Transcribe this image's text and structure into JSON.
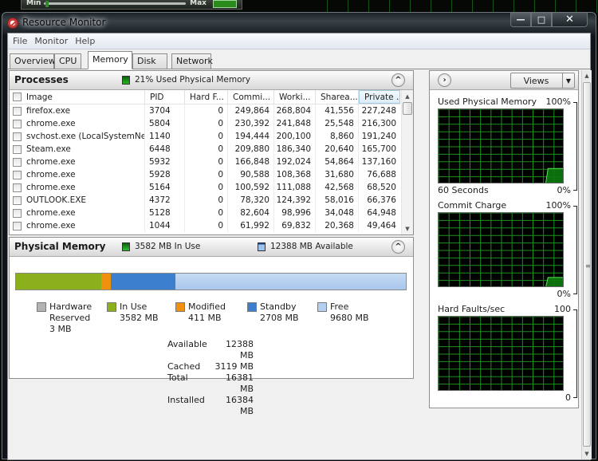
{
  "background": {
    "slider_min_label": "Min",
    "slider_max_label": "Max"
  },
  "window": {
    "title": "Resource Monitor",
    "icon": "resource-monitor-icon",
    "controls": {
      "minimize": "—",
      "maximize": "□",
      "close": "✕"
    }
  },
  "menu": [
    "File",
    "Monitor",
    "Help"
  ],
  "tabs": [
    {
      "label": "Overview",
      "active": false
    },
    {
      "label": "CPU",
      "active": false
    },
    {
      "label": "Memory",
      "active": true
    },
    {
      "label": "Disk",
      "active": false
    },
    {
      "label": "Network",
      "active": false
    }
  ],
  "processes": {
    "title": "Processes",
    "summary": "21% Used Physical Memory",
    "summary_color": "#1fb91f",
    "columns": [
      "Image",
      "PID",
      "Hard F...",
      "Commi...",
      "Worki...",
      "Sharea...",
      "Private ..."
    ],
    "sorted_column": "Private ...",
    "rows": [
      {
        "image": "firefox.exe",
        "pid": "3704",
        "hard_faults": "0",
        "commit": "249,864",
        "working": "268,804",
        "shareable": "41,556",
        "private": "227,248"
      },
      {
        "image": "chrome.exe",
        "pid": "5804",
        "hard_faults": "0",
        "commit": "230,392",
        "working": "241,848",
        "shareable": "25,548",
        "private": "216,300"
      },
      {
        "image": "svchost.exe (LocalSystemNet...",
        "pid": "1140",
        "hard_faults": "0",
        "commit": "194,444",
        "working": "200,100",
        "shareable": "8,860",
        "private": "191,240"
      },
      {
        "image": "Steam.exe",
        "pid": "6448",
        "hard_faults": "0",
        "commit": "209,880",
        "working": "186,340",
        "shareable": "20,640",
        "private": "165,700"
      },
      {
        "image": "chrome.exe",
        "pid": "5932",
        "hard_faults": "0",
        "commit": "166,848",
        "working": "192,024",
        "shareable": "54,864",
        "private": "137,160"
      },
      {
        "image": "chrome.exe",
        "pid": "5928",
        "hard_faults": "0",
        "commit": "90,588",
        "working": "108,368",
        "shareable": "31,680",
        "private": "76,688"
      },
      {
        "image": "chrome.exe",
        "pid": "5164",
        "hard_faults": "0",
        "commit": "100,592",
        "working": "111,088",
        "shareable": "42,568",
        "private": "68,520"
      },
      {
        "image": "OUTLOOK.EXE",
        "pid": "4372",
        "hard_faults": "0",
        "commit": "78,320",
        "working": "124,392",
        "shareable": "58,016",
        "private": "66,376"
      },
      {
        "image": "chrome.exe",
        "pid": "5128",
        "hard_faults": "0",
        "commit": "82,604",
        "working": "98,996",
        "shareable": "34,048",
        "private": "64,948"
      },
      {
        "image": "chrome.exe",
        "pid": "1044",
        "hard_faults": "0",
        "commit": "61,992",
        "working": "69,832",
        "shareable": "20,368",
        "private": "49,464"
      }
    ]
  },
  "physical_memory": {
    "title": "Physical Memory",
    "in_use_summary": "3582 MB In Use",
    "available_summary": "12388 MB Available",
    "bar_segments_mb": [
      {
        "name": "hardware-reserved",
        "value": 3,
        "color": "#a8a8a8"
      },
      {
        "name": "in-use",
        "value": 3582,
        "color": "#8cb01c"
      },
      {
        "name": "modified",
        "value": 411,
        "color": "#f0900c"
      },
      {
        "name": "standby",
        "value": 2708,
        "color": "#3d7fcf"
      },
      {
        "name": "free",
        "value": 9680,
        "color": "#b5cff0"
      }
    ],
    "legend": [
      {
        "label": "Hardware\nReserved\n3 MB",
        "color": "#b3b3b3"
      },
      {
        "label": "In Use\n3582 MB",
        "color": "#8cb01c"
      },
      {
        "label": "Modified\n411 MB",
        "color": "#f0900c"
      },
      {
        "label": "Standby\n2708 MB",
        "color": "#3d7fcf"
      },
      {
        "label": "Free\n9680 MB",
        "color": "#b5cff0"
      }
    ],
    "stats": [
      {
        "label": "Available",
        "value": "12388 MB"
      },
      {
        "label": "Cached",
        "value": "3119 MB"
      },
      {
        "label": "Total",
        "value": "16381 MB"
      },
      {
        "label": "Installed",
        "value": "16384 MB"
      }
    ]
  },
  "right_pane": {
    "views_label": "Views",
    "graphs": [
      {
        "title": "Used Physical Memory",
        "max_label": "100%",
        "min_label": "0%",
        "x_label": "60 Seconds",
        "current_percent": 21,
        "history_start_fraction": 0.85
      },
      {
        "title": "Commit Charge",
        "max_label": "100%",
        "min_label": "0%",
        "x_label": "",
        "current_percent": 14,
        "history_start_fraction": 0.85
      },
      {
        "title": "Hard Faults/sec",
        "max_label": "100",
        "min_label": "0",
        "x_label": "",
        "current_percent": 0,
        "history_start_fraction": 0.85
      }
    ]
  },
  "colors": {
    "graph_grid": "#1f8f1f",
    "graph_fill": "#0d7a0d",
    "graph_line": "#58e358"
  }
}
